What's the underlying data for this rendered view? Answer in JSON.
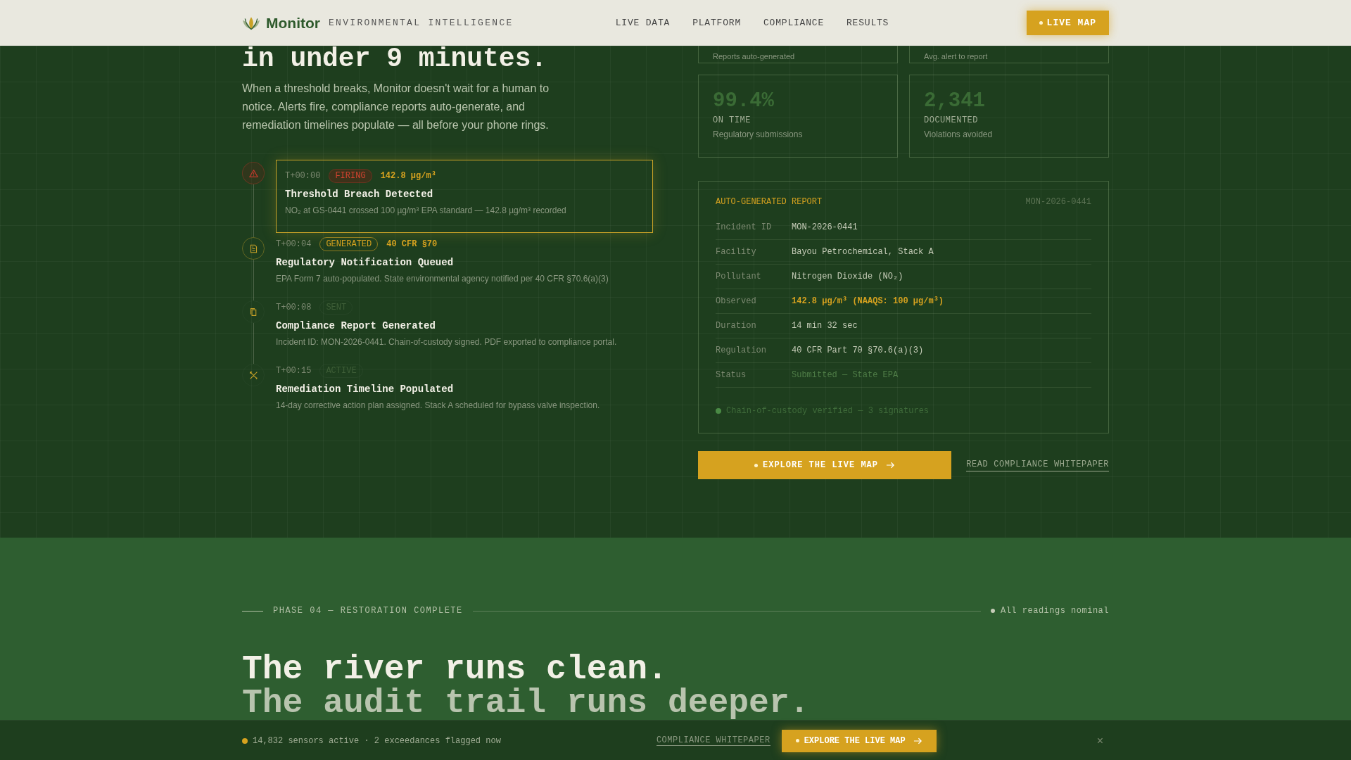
{
  "header": {
    "brand": "Monitor",
    "tagline": "ENVIRONMENTAL INTELLIGENCE",
    "nav": [
      "LIVE DATA",
      "PLATFORM",
      "COMPLIANCE",
      "RESULTS"
    ],
    "cta": "LIVE MAP"
  },
  "hero": {
    "heading": "in under 9 minutes.",
    "lead": "When a threshold breaks, Monitor doesn't wait for a human to notice. Alerts fire, compliance reports auto-generate, and remediation timelines populate — all before your phone rings."
  },
  "timeline": [
    {
      "time": "T+00:00",
      "badge": "FIRING",
      "kind": "firing",
      "metric": "142.8 µg/m³",
      "title": "Threshold Breach Detected",
      "detail": "NO₂ at GS-0441 crossed 100 µg/m³ EPA standard — 142.8 µg/m³ recorded",
      "highlighted": true
    },
    {
      "time": "T+00:04",
      "badge": "GENERATED",
      "kind": "generated",
      "metric": "40 CFR §70",
      "title": "Regulatory Notification Queued",
      "detail": "EPA Form 7 auto-populated. State environmental agency notified per 40 CFR §70.6(a)(3)",
      "highlighted": false
    },
    {
      "time": "T+00:08",
      "badge": "SENT",
      "kind": "pending",
      "title": "Compliance Report Generated",
      "detail": "Incident ID: MON-2026-0441. Chain-of-custody signed. PDF exported to compliance portal.",
      "highlighted": false
    },
    {
      "time": "T+00:15",
      "badge": "ACTIVE",
      "kind": "pending",
      "title": "Remediation Timeline Populated",
      "detail": "14-day corrective action plan assigned. Stack A scheduled for bypass valve inspection.",
      "highlighted": false
    }
  ],
  "stats_partial": [
    {
      "caption": "Reports auto-generated"
    },
    {
      "caption": "Avg. alert to report"
    }
  ],
  "stats": [
    {
      "value": "99.4%",
      "label": "ON TIME",
      "caption": "Regulatory submissions"
    },
    {
      "value": "2,341",
      "label": "DOCUMENTED",
      "caption": "Violations avoided"
    }
  ],
  "report": {
    "title": "AUTO-GENERATED REPORT",
    "id": "MON-2026-0441",
    "rows": [
      {
        "label": "Incident ID",
        "value": "MON-2026-0441",
        "kind": "plain"
      },
      {
        "label": "Facility",
        "value": "Bayou Petrochemical, Stack A",
        "kind": "plain"
      },
      {
        "label": "Pollutant",
        "value": "Nitrogen Dioxide (NO₂)",
        "kind": "plain"
      },
      {
        "label": "Observed",
        "value": "142.8 µg/m³ (NAAQS: 100 µg/m³)",
        "kind": "alert"
      },
      {
        "label": "Duration",
        "value": "14 min 32 sec",
        "kind": "plain"
      },
      {
        "label": "Regulation",
        "value": "40 CFR Part 70 §70.6(a)(3)",
        "kind": "plain"
      },
      {
        "label": "Status",
        "value": "Submitted — State EPA",
        "kind": "status"
      }
    ],
    "footnote": "Chain-of-custody verified — 3 signatures"
  },
  "actions": {
    "primary": "EXPLORE THE LIVE MAP",
    "secondary": "READ COMPLIANCE WHITEPAPER"
  },
  "phase": {
    "label": "PHASE 04 — RESTORATION COMPLETE",
    "status": "All readings nominal",
    "line1": "The river runs clean.",
    "line2": "The audit trail runs deeper."
  },
  "bar": {
    "status": "14,832 sensors active · 2 exceedances flagged now",
    "link": "COMPLIANCE WHITEPAPER",
    "cta": "EXPLORE THE LIVE MAP",
    "close": "×"
  }
}
